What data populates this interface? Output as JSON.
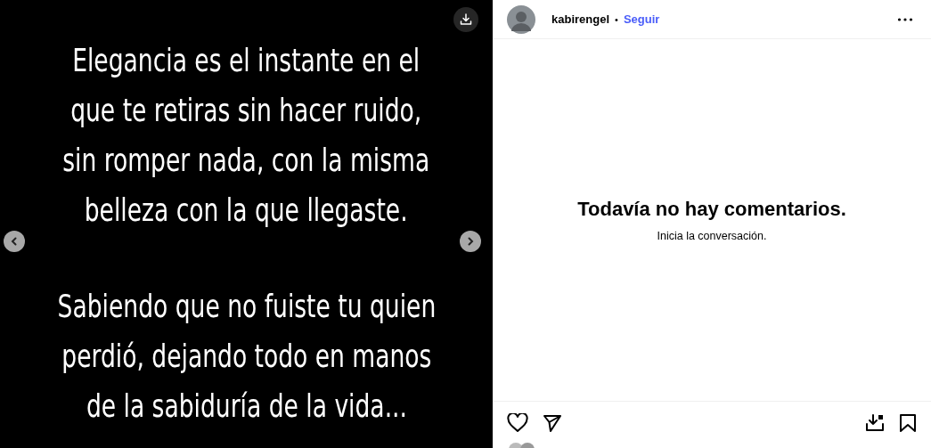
{
  "post": {
    "paragraphs": [
      [
        "Elegancia es el instante en el",
        "que te retiras sin hacer ruido,",
        "sin romper nada, con la misma",
        "belleza con la que llegaste."
      ],
      [
        "Sabiendo que no fuiste tu quien",
        "perdió, dejando todo en manos",
        "de la sabiduría de la vida..."
      ]
    ]
  },
  "header": {
    "username": "kabirengel",
    "separator": "•",
    "follow": "Seguir"
  },
  "comments": {
    "title": "Todavía no hay comentarios.",
    "subtitle": "Inicia la conversación."
  }
}
